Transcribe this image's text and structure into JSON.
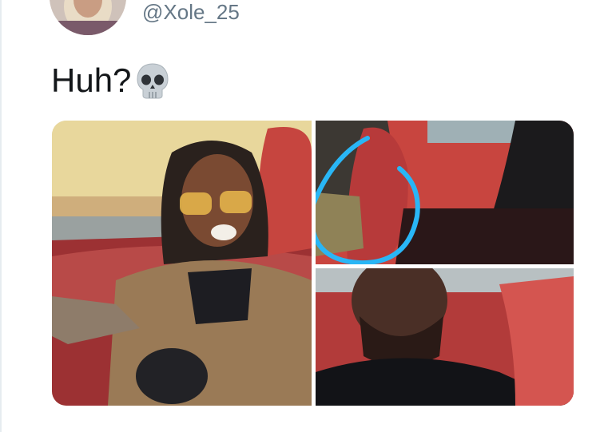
{
  "tweet": {
    "handle": "@Xole_25",
    "text": "Huh?",
    "emoji_icon": "skull-emoji-icon"
  },
  "media": {
    "count": 3,
    "highlight_color": "#29b6f6"
  }
}
